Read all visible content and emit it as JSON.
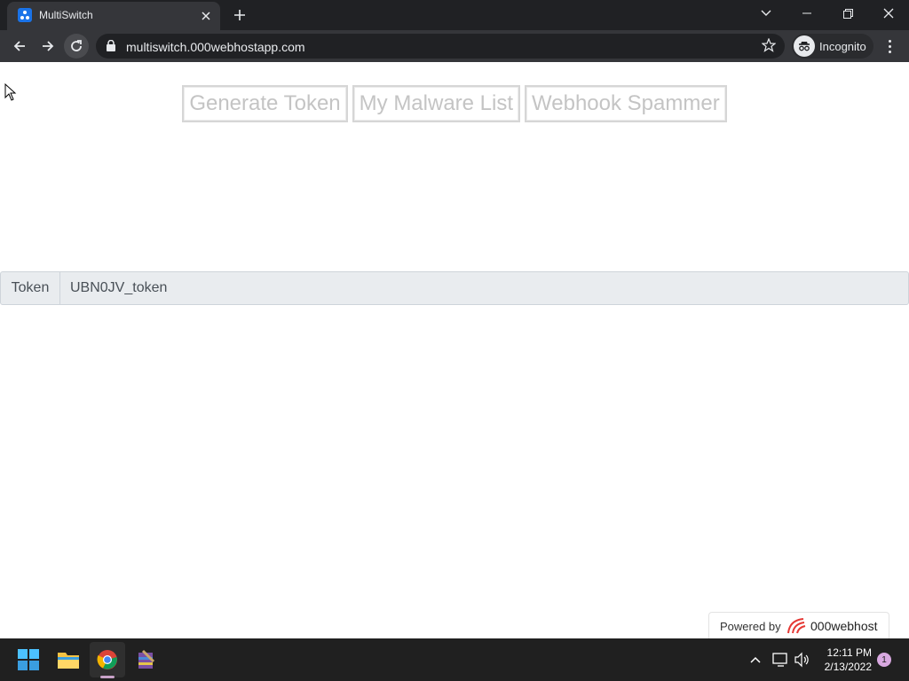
{
  "browser": {
    "tab": {
      "title": "MultiSwitch",
      "favicon": "multiswitch-favicon-icon"
    },
    "url": "multiswitch.000webhostapp.com",
    "profile_label": "Incognito"
  },
  "page": {
    "buttons": [
      {
        "label": "Generate Token"
      },
      {
        "label": "My Malware List"
      },
      {
        "label": "Webhook Spammer"
      }
    ],
    "token": {
      "label": "Token",
      "value": "UBN0JV_token"
    },
    "footer": {
      "powered_by": "Powered by",
      "brand": "000webhost"
    }
  },
  "taskbar": {
    "apps": [
      "windows-start-icon",
      "file-explorer-icon",
      "chrome-icon",
      "winrar-icon"
    ],
    "time": "12:11 PM",
    "date": "2/13/2022",
    "notification_count": "1"
  },
  "colors": {
    "titlebar": "#202124",
    "toolbar": "#35363a",
    "token_bg": "#e9ecef",
    "button_text": "#c4c4c4",
    "taskbar": "#202020"
  }
}
